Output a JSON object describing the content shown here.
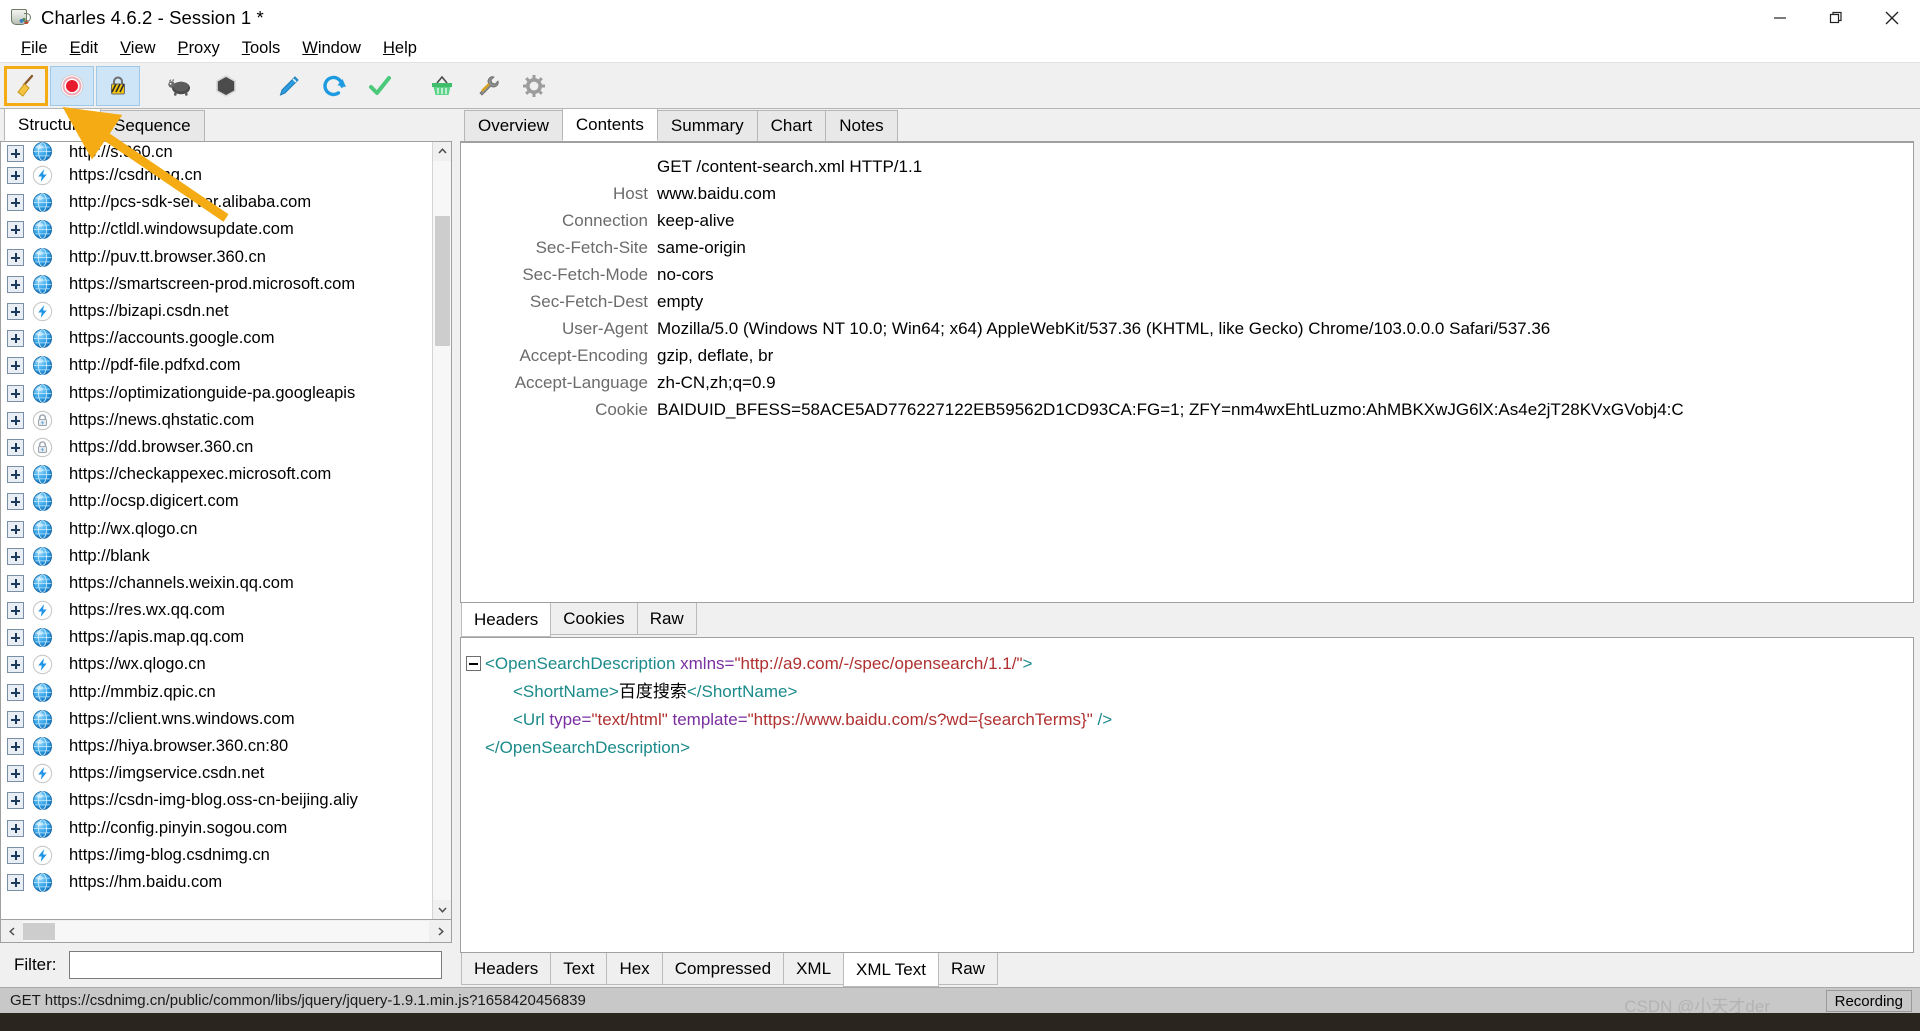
{
  "window": {
    "title": "Charles 4.6.2 - Session 1 *",
    "app_icon": "charles-cup-icon",
    "minimize_label": "Minimize",
    "maximize_label": "Restore",
    "close_label": "Close"
  },
  "menubar": {
    "items": [
      {
        "label": "File",
        "mnemonic": "F"
      },
      {
        "label": "Edit",
        "mnemonic": "E"
      },
      {
        "label": "View",
        "mnemonic": "V"
      },
      {
        "label": "Proxy",
        "mnemonic": "P"
      },
      {
        "label": "Tools",
        "mnemonic": "T"
      },
      {
        "label": "Window",
        "mnemonic": "W"
      },
      {
        "label": "Help",
        "mnemonic": "H"
      }
    ]
  },
  "toolbar": {
    "highlight_color": "#f5ab13",
    "buttons": [
      {
        "name": "clear-session-button",
        "icon": "broom-icon",
        "selected": true,
        "toggled": false
      },
      {
        "name": "record-button",
        "icon": "record-circle-icon",
        "selected": false,
        "toggled": true
      },
      {
        "name": "throttle-button",
        "icon": "lock-barrier-icon",
        "selected": false,
        "toggled": true
      },
      {
        "name": "throttle-settings-button",
        "icon": "turtle-icon",
        "selected": false,
        "toggled": false
      },
      {
        "name": "breakpoints-button",
        "icon": "hexagon-icon",
        "selected": false,
        "toggled": false
      },
      {
        "name": "compose-button",
        "icon": "pen-icon",
        "selected": false,
        "toggled": false
      },
      {
        "name": "repeat-button",
        "icon": "refresh-icon",
        "selected": false,
        "toggled": false
      },
      {
        "name": "validate-button",
        "icon": "checkmark-icon",
        "selected": false,
        "toggled": false
      },
      {
        "name": "tools-basket-button",
        "icon": "basket-icon",
        "selected": false,
        "toggled": false
      },
      {
        "name": "tools-wrench-button",
        "icon": "wrench-icon",
        "selected": false,
        "toggled": false
      },
      {
        "name": "settings-button",
        "icon": "gear-icon",
        "selected": false,
        "toggled": false
      }
    ]
  },
  "left_panel": {
    "tabs": [
      {
        "label": "Structure",
        "active": true
      },
      {
        "label": "Sequence",
        "active": false
      }
    ],
    "tree": [
      {
        "label": "http://s.360.cn",
        "icon": "globe-icon",
        "clipped_top": true
      },
      {
        "label": "https://csdnimg.cn",
        "icon": "lightning-icon"
      },
      {
        "label": "http://pcs-sdk-server.alibaba.com",
        "icon": "globe-icon"
      },
      {
        "label": "http://ctldl.windowsupdate.com",
        "icon": "globe-icon"
      },
      {
        "label": "http://puv.tt.browser.360.cn",
        "icon": "globe-icon"
      },
      {
        "label": "https://smartscreen-prod.microsoft.com",
        "icon": "globe-icon"
      },
      {
        "label": "https://bizapi.csdn.net",
        "icon": "lightning-icon"
      },
      {
        "label": "https://accounts.google.com",
        "icon": "globe-icon"
      },
      {
        "label": "http://pdf-file.pdfxd.com",
        "icon": "globe-icon"
      },
      {
        "label": "https://optimizationguide-pa.googleapis",
        "icon": "globe-icon"
      },
      {
        "label": "https://news.qhstatic.com",
        "icon": "lock-icon"
      },
      {
        "label": "https://dd.browser.360.cn",
        "icon": "lock-icon"
      },
      {
        "label": "https://checkappexec.microsoft.com",
        "icon": "globe-icon"
      },
      {
        "label": "http://ocsp.digicert.com",
        "icon": "globe-icon"
      },
      {
        "label": "http://wx.qlogo.cn",
        "icon": "globe-icon"
      },
      {
        "label": "http://blank",
        "icon": "globe-icon"
      },
      {
        "label": "https://channels.weixin.qq.com",
        "icon": "globe-icon"
      },
      {
        "label": "https://res.wx.qq.com",
        "icon": "lightning-icon"
      },
      {
        "label": "https://apis.map.qq.com",
        "icon": "globe-icon"
      },
      {
        "label": "https://wx.qlogo.cn",
        "icon": "lightning-icon"
      },
      {
        "label": "http://mmbiz.qpic.cn",
        "icon": "globe-icon"
      },
      {
        "label": "https://client.wns.windows.com",
        "icon": "globe-icon"
      },
      {
        "label": "https://hiya.browser.360.cn:80",
        "icon": "globe-icon"
      },
      {
        "label": "https://imgservice.csdn.net",
        "icon": "lightning-icon"
      },
      {
        "label": "https://csdn-img-blog.oss-cn-beijing.aliy",
        "icon": "globe-icon"
      },
      {
        "label": "http://config.pinyin.sogou.com",
        "icon": "globe-icon"
      },
      {
        "label": "https://img-blog.csdnimg.cn",
        "icon": "lightning-icon"
      },
      {
        "label": "https://hm.baidu.com",
        "icon": "globe-icon"
      }
    ],
    "filter": {
      "label": "Filter:",
      "value": "",
      "placeholder": ""
    }
  },
  "request_pane": {
    "tabs": [
      {
        "label": "Overview",
        "active": false
      },
      {
        "label": "Contents",
        "active": true
      },
      {
        "label": "Summary",
        "active": false
      },
      {
        "label": "Chart",
        "active": false
      },
      {
        "label": "Notes",
        "active": false
      }
    ],
    "request_line": "GET /content-search.xml HTTP/1.1",
    "headers": [
      {
        "name": "Host",
        "value": "www.baidu.com"
      },
      {
        "name": "Connection",
        "value": "keep-alive"
      },
      {
        "name": "Sec-Fetch-Site",
        "value": "same-origin"
      },
      {
        "name": "Sec-Fetch-Mode",
        "value": "no-cors"
      },
      {
        "name": "Sec-Fetch-Dest",
        "value": "empty"
      },
      {
        "name": "User-Agent",
        "value": "Mozilla/5.0 (Windows NT 10.0; Win64; x64) AppleWebKit/537.36 (KHTML, like Gecko) Chrome/103.0.0.0 Safari/537.36"
      },
      {
        "name": "Accept-Encoding",
        "value": "gzip, deflate, br"
      },
      {
        "name": "Accept-Language",
        "value": "zh-CN,zh;q=0.9"
      },
      {
        "name": "Cookie",
        "value": "BAIDUID_BFESS=58ACE5AD776227122EB59562D1CD93CA:FG=1; ZFY=nm4wxEhtLuzmo:AhMBKXwJG6lX:As4e2jT28KVxGVobj4:C"
      }
    ],
    "subtabs": [
      {
        "label": "Headers",
        "active": true
      },
      {
        "label": "Cookies",
        "active": false
      },
      {
        "label": "Raw",
        "active": false
      }
    ]
  },
  "response_pane": {
    "xml": {
      "lines": [
        {
          "indent": 0,
          "collapsible": true,
          "tokens": [
            {
              "t": "<OpenSearchDescription",
              "c": "tag"
            },
            {
              "t": " xmlns=",
              "c": "attr"
            },
            {
              "t": "\"http://a9.com/-/spec/opensearch/1.1/\"",
              "c": "str"
            },
            {
              "t": ">",
              "c": "tag"
            }
          ]
        },
        {
          "indent": 1,
          "collapsible": false,
          "tokens": [
            {
              "t": "<ShortName>",
              "c": "tag"
            },
            {
              "t": "百度搜索",
              "c": "text"
            },
            {
              "t": "</ShortName>",
              "c": "tag"
            }
          ]
        },
        {
          "indent": 1,
          "collapsible": false,
          "tokens": [
            {
              "t": "<Url",
              "c": "tag"
            },
            {
              "t": " type=",
              "c": "attr"
            },
            {
              "t": "\"text/html\"",
              "c": "str"
            },
            {
              "t": " template=",
              "c": "attr"
            },
            {
              "t": "\"https://www.baidu.com/s?wd={searchTerms}\"",
              "c": "str"
            },
            {
              "t": " />",
              "c": "tag"
            }
          ]
        },
        {
          "indent": 0,
          "collapsible": false,
          "tokens": [
            {
              "t": "</OpenSearchDescription>",
              "c": "tag"
            }
          ]
        }
      ]
    },
    "subtabs": [
      {
        "label": "Headers",
        "active": false
      },
      {
        "label": "Text",
        "active": false
      },
      {
        "label": "Hex",
        "active": false
      },
      {
        "label": "Compressed",
        "active": false
      },
      {
        "label": "XML",
        "active": false
      },
      {
        "label": "XML Text",
        "active": true
      },
      {
        "label": "Raw",
        "active": false
      }
    ]
  },
  "statusbar": {
    "text": "GET https://csdnimg.cn/public/common/libs/jquery/jquery-1.9.1.min.js?1658420456839",
    "recording_label": "Recording",
    "watermark": "CSDN @小天才der"
  },
  "annotation": {
    "arrow_color": "#f5ab13",
    "description": "orange arrow pointing from Structure tab up-left to clear-session toolbar button"
  }
}
